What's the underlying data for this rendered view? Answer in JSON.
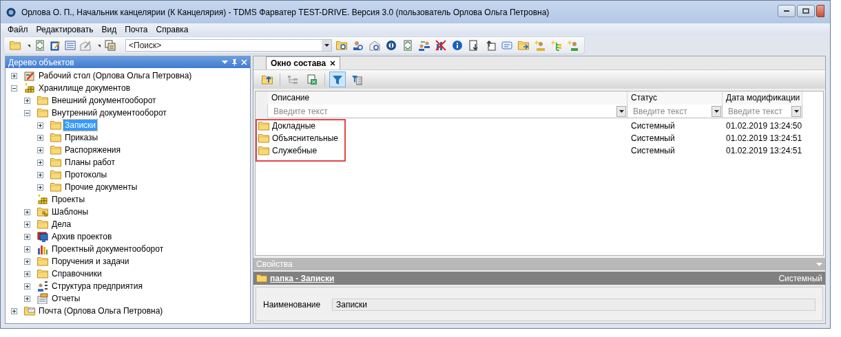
{
  "window": {
    "title": "Орлова О. П., Начальник канцелярии (К Канцелярия) - TDMS Фарватер TEST-DRIVE. Версия 3.0 (пользователь Орлова Ольга Петровна)"
  },
  "menu": [
    "Файл",
    "Редактировать",
    "Вид",
    "Почта",
    "Справка"
  ],
  "search": {
    "placeholder": "<Поиск>"
  },
  "tree": {
    "title": "Дерево объектов",
    "items": [
      {
        "label": "Рабочий стол (Орлова Ольга Петровна)",
        "kind": "desktop",
        "expanded": false,
        "selected": false
      },
      {
        "label": "Хранилище документов",
        "kind": "storage",
        "expanded": true,
        "selected": false,
        "children": [
          {
            "label": "Внешний документооборот",
            "kind": "folder",
            "expanded": false,
            "selected": false
          },
          {
            "label": "Внутренний документооборот",
            "kind": "folder",
            "expanded": true,
            "selected": false,
            "children": [
              {
                "label": "Записки",
                "kind": "folder",
                "expanded": false,
                "selected": true
              },
              {
                "label": "Приказы",
                "kind": "folder",
                "expanded": false,
                "selected": false
              },
              {
                "label": "Распоряжения",
                "kind": "folder",
                "expanded": false,
                "selected": false
              },
              {
                "label": "Планы работ",
                "kind": "folder",
                "expanded": false,
                "selected": false
              },
              {
                "label": "Протоколы",
                "kind": "folder",
                "expanded": false,
                "selected": false
              },
              {
                "label": "Прочие документы",
                "kind": "folder",
                "expanded": false,
                "selected": false
              }
            ]
          },
          {
            "label": "Проекты",
            "kind": "storage",
            "selected": false
          },
          {
            "label": "Шаблоны",
            "kind": "template",
            "expanded": false,
            "selected": false
          },
          {
            "label": "Дела",
            "kind": "folder",
            "expanded": false,
            "selected": false
          },
          {
            "label": "Архив проектов",
            "kind": "archive",
            "expanded": false,
            "selected": false
          },
          {
            "label": "Проектный документооборот",
            "kind": "chart",
            "expanded": false,
            "selected": false
          },
          {
            "label": "Поручения и задачи",
            "kind": "folder",
            "expanded": false,
            "selected": false
          },
          {
            "label": "Справочники",
            "kind": "folder",
            "expanded": false,
            "selected": false
          },
          {
            "label": "Структура предприятия",
            "kind": "structure",
            "expanded": false,
            "selected": false
          },
          {
            "label": "Отчеты",
            "kind": "report",
            "expanded": false,
            "selected": false
          }
        ]
      },
      {
        "label": "Почта (Орлова Ольга Петровна)",
        "kind": "mail",
        "expanded": false,
        "selected": false
      }
    ]
  },
  "content": {
    "tabs": [
      {
        "label": "Окно состава",
        "selected": true
      }
    ],
    "toolbar": [
      {
        "kind": "up",
        "pressed": false
      },
      {
        "kind": "tree",
        "pressed": false
      },
      {
        "kind": "export",
        "pressed": false
      },
      {
        "kind": "filter",
        "pressed": true
      },
      {
        "kind": "filter-list",
        "pressed": false
      }
    ],
    "table": {
      "columns": [
        "Описание",
        "Статус",
        "Дата модификации"
      ],
      "filters": [
        {
          "placeholder": "Введите текст"
        },
        {
          "placeholder": "Введите текст"
        },
        {
          "placeholder": "Введите текст"
        }
      ],
      "rows": [
        {
          "description": "Докладные",
          "status": "Системный",
          "modified": "01.02.2019 13:24:50",
          "highlighted": true
        },
        {
          "description": "Объяснительные",
          "status": "Системный",
          "modified": "01.02.2019 13:24:51",
          "highlighted": true
        },
        {
          "description": "Служебные",
          "status": "Системный",
          "modified": "01.02.2019 13:24:51",
          "highlighted": true
        }
      ]
    }
  },
  "properties": {
    "title": "Свойства",
    "object": "папка - Записки",
    "status": "Системный",
    "fields": [
      {
        "label": "Наименование",
        "value": "Записки"
      }
    ]
  }
}
